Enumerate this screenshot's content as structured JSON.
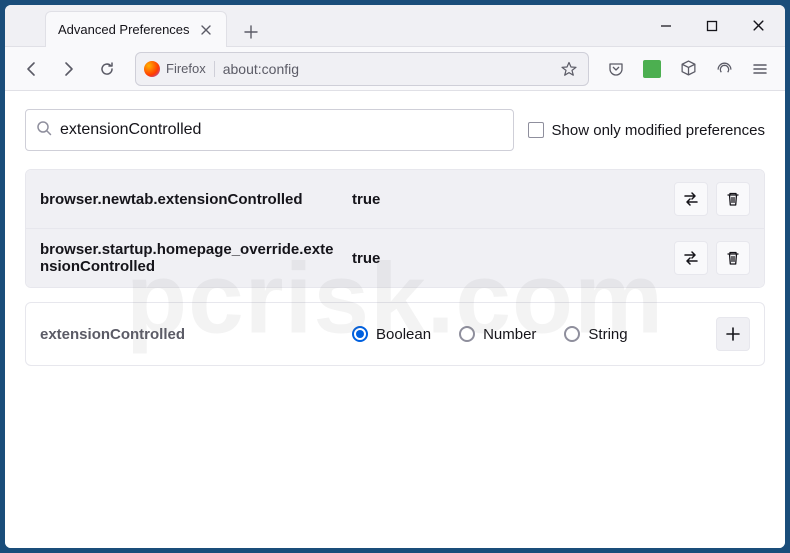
{
  "window": {
    "tab_title": "Advanced Preferences"
  },
  "toolbar": {
    "identity_label": "Firefox",
    "url": "about:config"
  },
  "content": {
    "search_value": "extensionControlled",
    "show_modified_label": "Show only modified preferences",
    "prefs": [
      {
        "name": "browser.newtab.extensionControlled",
        "value": "true"
      },
      {
        "name": "browser.startup.homepage_override.extensionControlled",
        "value": "true"
      }
    ],
    "new_pref": {
      "name": "extensionControlled",
      "types": [
        "Boolean",
        "Number",
        "String"
      ],
      "selected": "Boolean"
    }
  },
  "watermark": "pcrisk.com"
}
